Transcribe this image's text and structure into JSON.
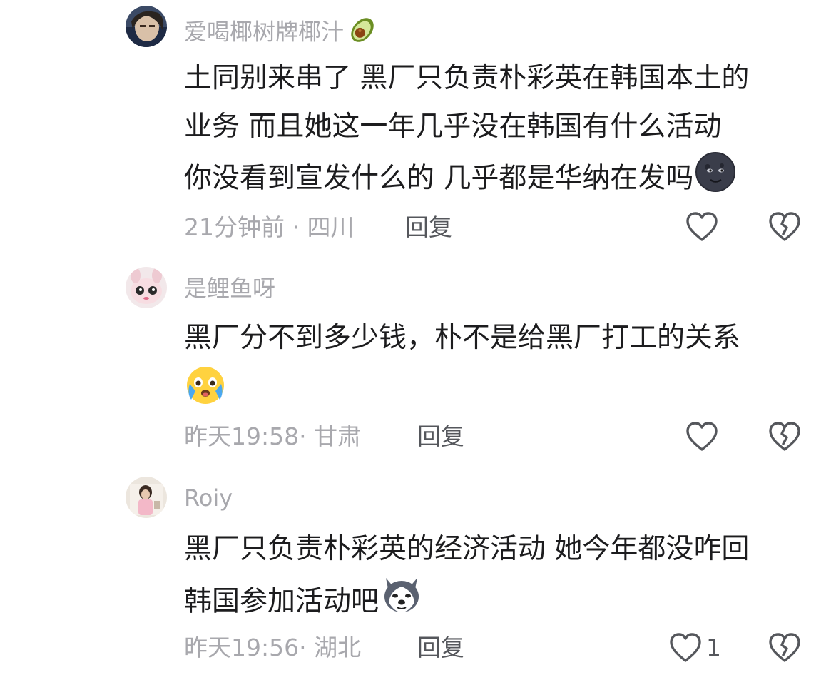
{
  "comments": [
    {
      "username": "爱喝椰树牌椰汁",
      "username_emoji": "avocado-icon",
      "lines": [
        "土同别来串了 黑厂只负责朴彩英在韩国本土的",
        "业务 而且她这一年几乎没在韩国有什么活动",
        "你没看到宣发什么的 几乎都是华纳在发吗"
      ],
      "trailing_emoji": "new-moon-face-icon",
      "time": "21分钟前",
      "separator": "·",
      "location": "四川",
      "reply_label": "回复",
      "like_count": ""
    },
    {
      "username": "是鲤鱼呀",
      "lines": [
        "黑厂分不到多少钱，朴不是给黑厂打工的关系"
      ],
      "trailing_emoji": "crying-face-icon",
      "time": "昨天19:58",
      "separator": "·",
      "location": "甘肃",
      "reply_label": "回复",
      "like_count": ""
    },
    {
      "username": "Roiy",
      "lines": [
        "黑厂只负责朴彩英的经济活动 她今年都没咋回",
        "韩国参加活动吧"
      ],
      "trailing_emoji": "husky-dog-face-icon",
      "time": "昨天19:56",
      "separator": "·",
      "location": "湖北",
      "reply_label": "回复",
      "like_count": "1"
    }
  ]
}
